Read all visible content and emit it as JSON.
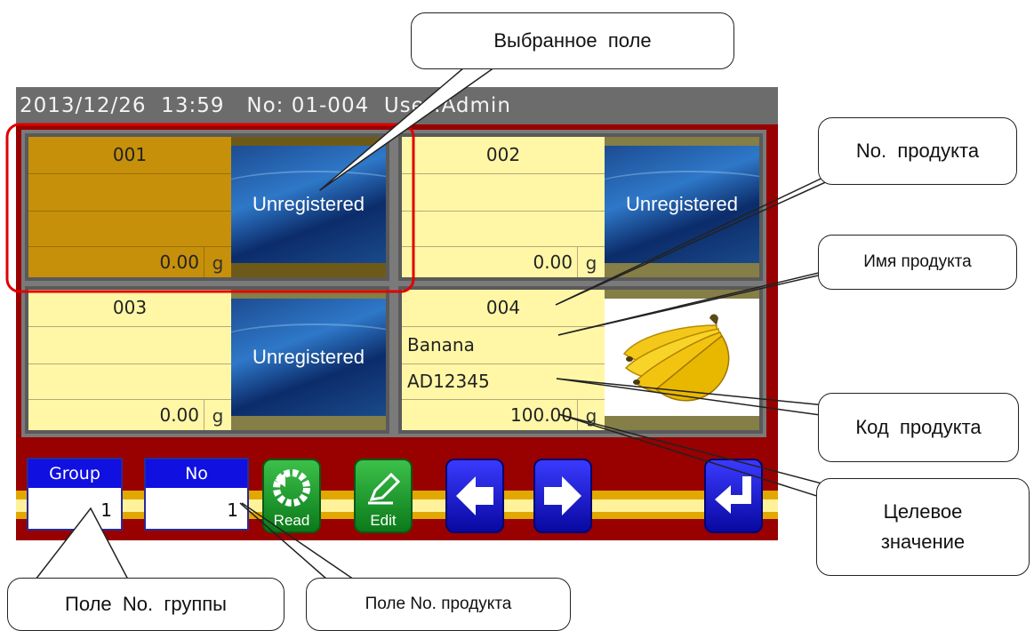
{
  "status_bar": {
    "text": "2013/12/26  13:59   No: 01-004  User:Admin"
  },
  "cells": [
    {
      "no": "001",
      "name": "",
      "code": "",
      "target": "0.00",
      "unit": "g",
      "image": "Unregistered",
      "selected": true
    },
    {
      "no": "002",
      "name": "",
      "code": "",
      "target": "0.00",
      "unit": "g",
      "image": "Unregistered",
      "selected": false
    },
    {
      "no": "003",
      "name": "",
      "code": "",
      "target": "0.00",
      "unit": "g",
      "image": "Unregistered",
      "selected": false
    },
    {
      "no": "004",
      "name": "Banana",
      "code": "AD12345",
      "target": "100.00",
      "unit": "g",
      "image": "banana-photo",
      "selected": false
    }
  ],
  "toolbar": {
    "group_label": "Group",
    "group_value": "1",
    "no_label": "No",
    "no_value": "1",
    "read_label": "Read",
    "edit_label": "Edit",
    "read_icon": "read-icon",
    "edit_icon": "pencil-icon",
    "prev_icon": "arrow-left-icon",
    "next_icon": "arrow-right-icon",
    "return_icon": "return-icon"
  },
  "callouts": {
    "selected_field": "Выбранное  поле",
    "product_no": "No.  продукта",
    "product_name": "Имя продукта",
    "product_code": "Код  продукта",
    "target_value_1": "Целевое",
    "target_value_2": "значение",
    "group_no_field": "Поле  No.  группы",
    "product_no_field": "Поле No. продукта"
  },
  "colors": {
    "screen_bg": "#990000",
    "selected_cell": "#c6900a",
    "cell": "#fff7a6",
    "field_header": "#1010e0",
    "selection_outline": "#e00000"
  }
}
